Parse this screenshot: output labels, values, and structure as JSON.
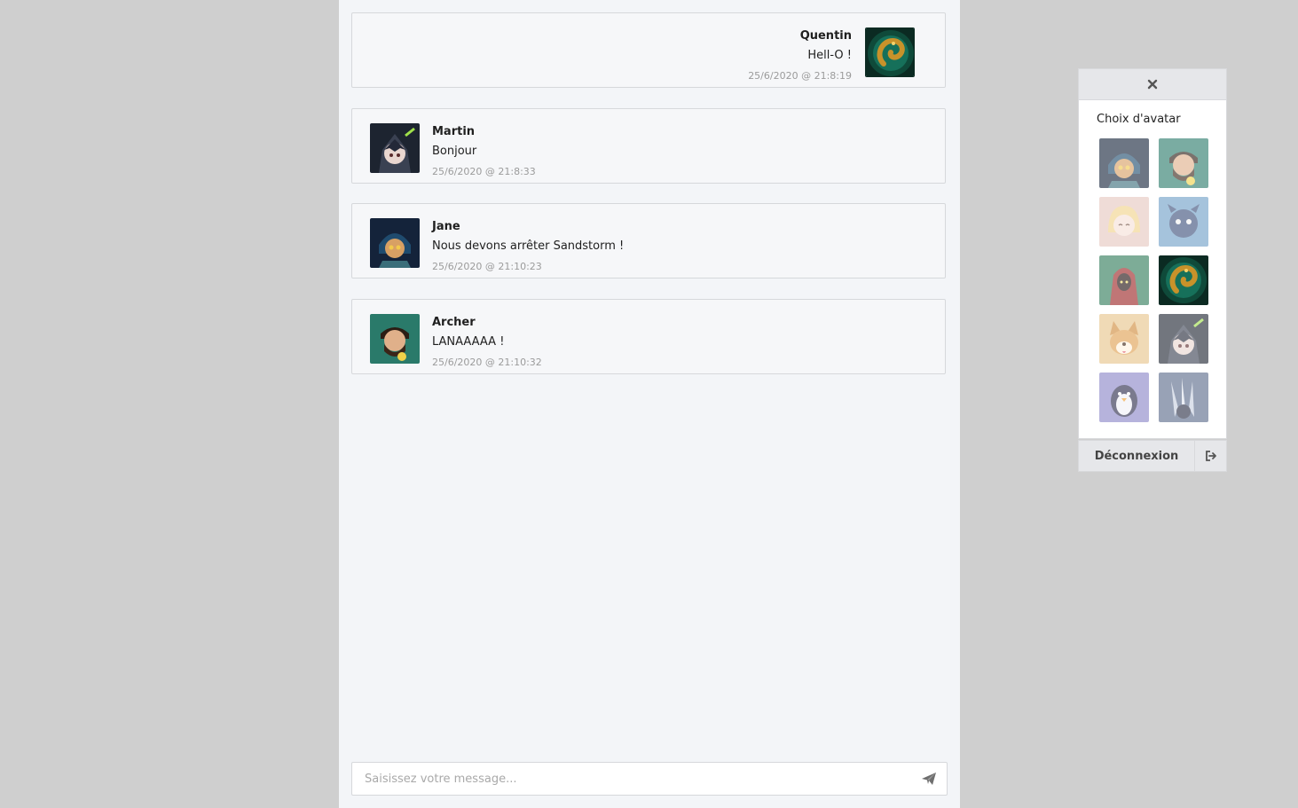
{
  "messages": [
    {
      "author": "Quentin",
      "text": "Hell-O !",
      "timestamp": "25/6/2020 @ 21:8:19",
      "align": "right",
      "avatar": "serpent-avatar"
    },
    {
      "author": "Martin",
      "text": "Bonjour",
      "timestamp": "25/6/2020 @ 21:8:33",
      "align": "left",
      "avatar": "dark-knight-avatar"
    },
    {
      "author": "Jane",
      "text": "Nous devons arrêter Sandstorm !",
      "timestamp": "25/6/2020 @ 21:10:23",
      "align": "left",
      "avatar": "helmet-hero-avatar"
    },
    {
      "author": "Archer",
      "text": "LANAAAAA !",
      "timestamp": "25/6/2020 @ 21:10:32",
      "align": "left",
      "avatar": "bearded-warrior-avatar"
    }
  ],
  "composer": {
    "placeholder": "Saisissez votre message...",
    "send_icon": "paper-plane-icon"
  },
  "avatar_panel": {
    "close_icon": "close-icon",
    "title": "Choix d'avatar",
    "selected_index": 5,
    "avatars": [
      "helmet-hero-avatar",
      "bearded-warrior-avatar",
      "blonde-girl-avatar",
      "blue-creature-avatar",
      "red-hood-avatar",
      "serpent-avatar",
      "corgi-avatar",
      "dark-knight-avatar",
      "penguin-avatar",
      "armored-claw-avatar"
    ]
  },
  "logout": {
    "label": "Déconnexion",
    "icon": "sign-out-icon"
  },
  "colors": {
    "page_background": "#cfcfcf",
    "chat_background": "#f3f5f8",
    "card_border": "#d6d8db",
    "timestamp": "#9b9b9b"
  }
}
